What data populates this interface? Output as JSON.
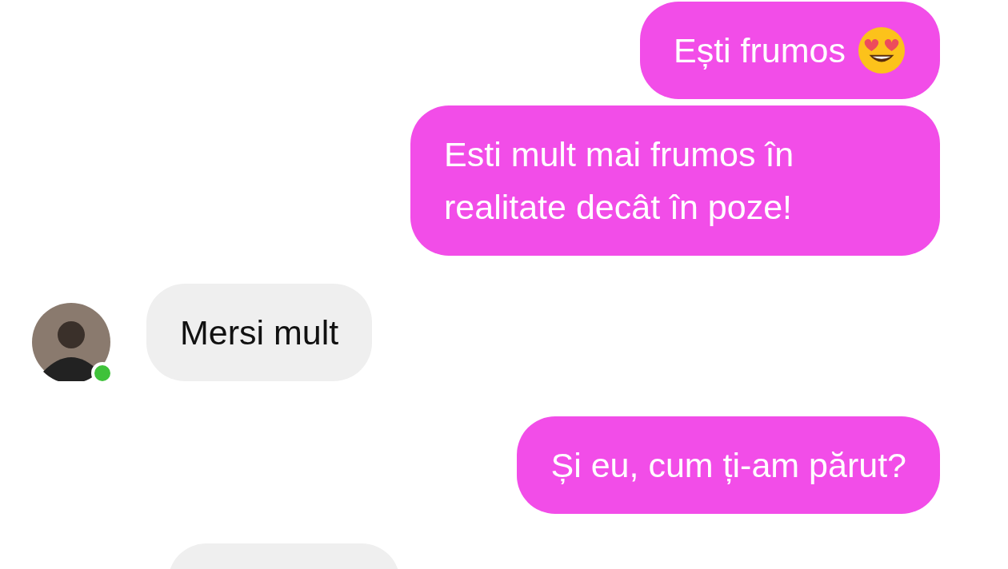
{
  "messages": [
    {
      "kind": "outgoing",
      "text": "Ești frumos",
      "emoji": true
    },
    {
      "kind": "outgoing",
      "text": "Esti mult mai frumos în realitate decât în poze!",
      "emoji": false
    },
    {
      "kind": "incoming",
      "text": "Mersi mult",
      "online": true
    },
    {
      "kind": "outgoing",
      "text": "Și eu, cum ți-am părut?",
      "emoji": false
    },
    {
      "kind": "incoming_cut"
    }
  ]
}
